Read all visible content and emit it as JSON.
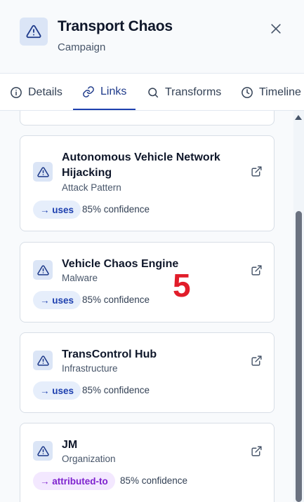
{
  "header": {
    "title": "Transport Chaos",
    "subtitle": "Campaign",
    "icon": "warning-triangle-icon"
  },
  "tabs": [
    {
      "label": "Details",
      "icon": "info-icon",
      "active": false
    },
    {
      "label": "Links",
      "icon": "link-icon",
      "active": true
    },
    {
      "label": "Transforms",
      "icon": "search-icon",
      "active": false
    },
    {
      "label": "Timeline",
      "icon": "clock-icon",
      "active": false
    }
  ],
  "links": [
    {
      "title": "Autonomous Vehicle Network Hijacking",
      "type": "Attack Pattern",
      "relation": "→ uses",
      "confidence": "85% confidence"
    },
    {
      "title": "Vehicle Chaos Engine",
      "type": "Malware",
      "relation": "→ uses",
      "confidence": "85% confidence"
    },
    {
      "title": "TransControl Hub",
      "type": "Infrastructure",
      "relation": "→ uses",
      "confidence": "85% confidence"
    },
    {
      "title": "JM",
      "type": "Organization",
      "relation": "→ attributed-to",
      "confidence": "85% confidence"
    }
  ],
  "marker": "5",
  "colors": {
    "accent": "#1e40af",
    "uses_pill_bg": "#e6eefb",
    "attributed_pill_bg": "#f3e8ff",
    "attributed_pill_text": "#7e22ce",
    "marker": "#e11d2a"
  }
}
